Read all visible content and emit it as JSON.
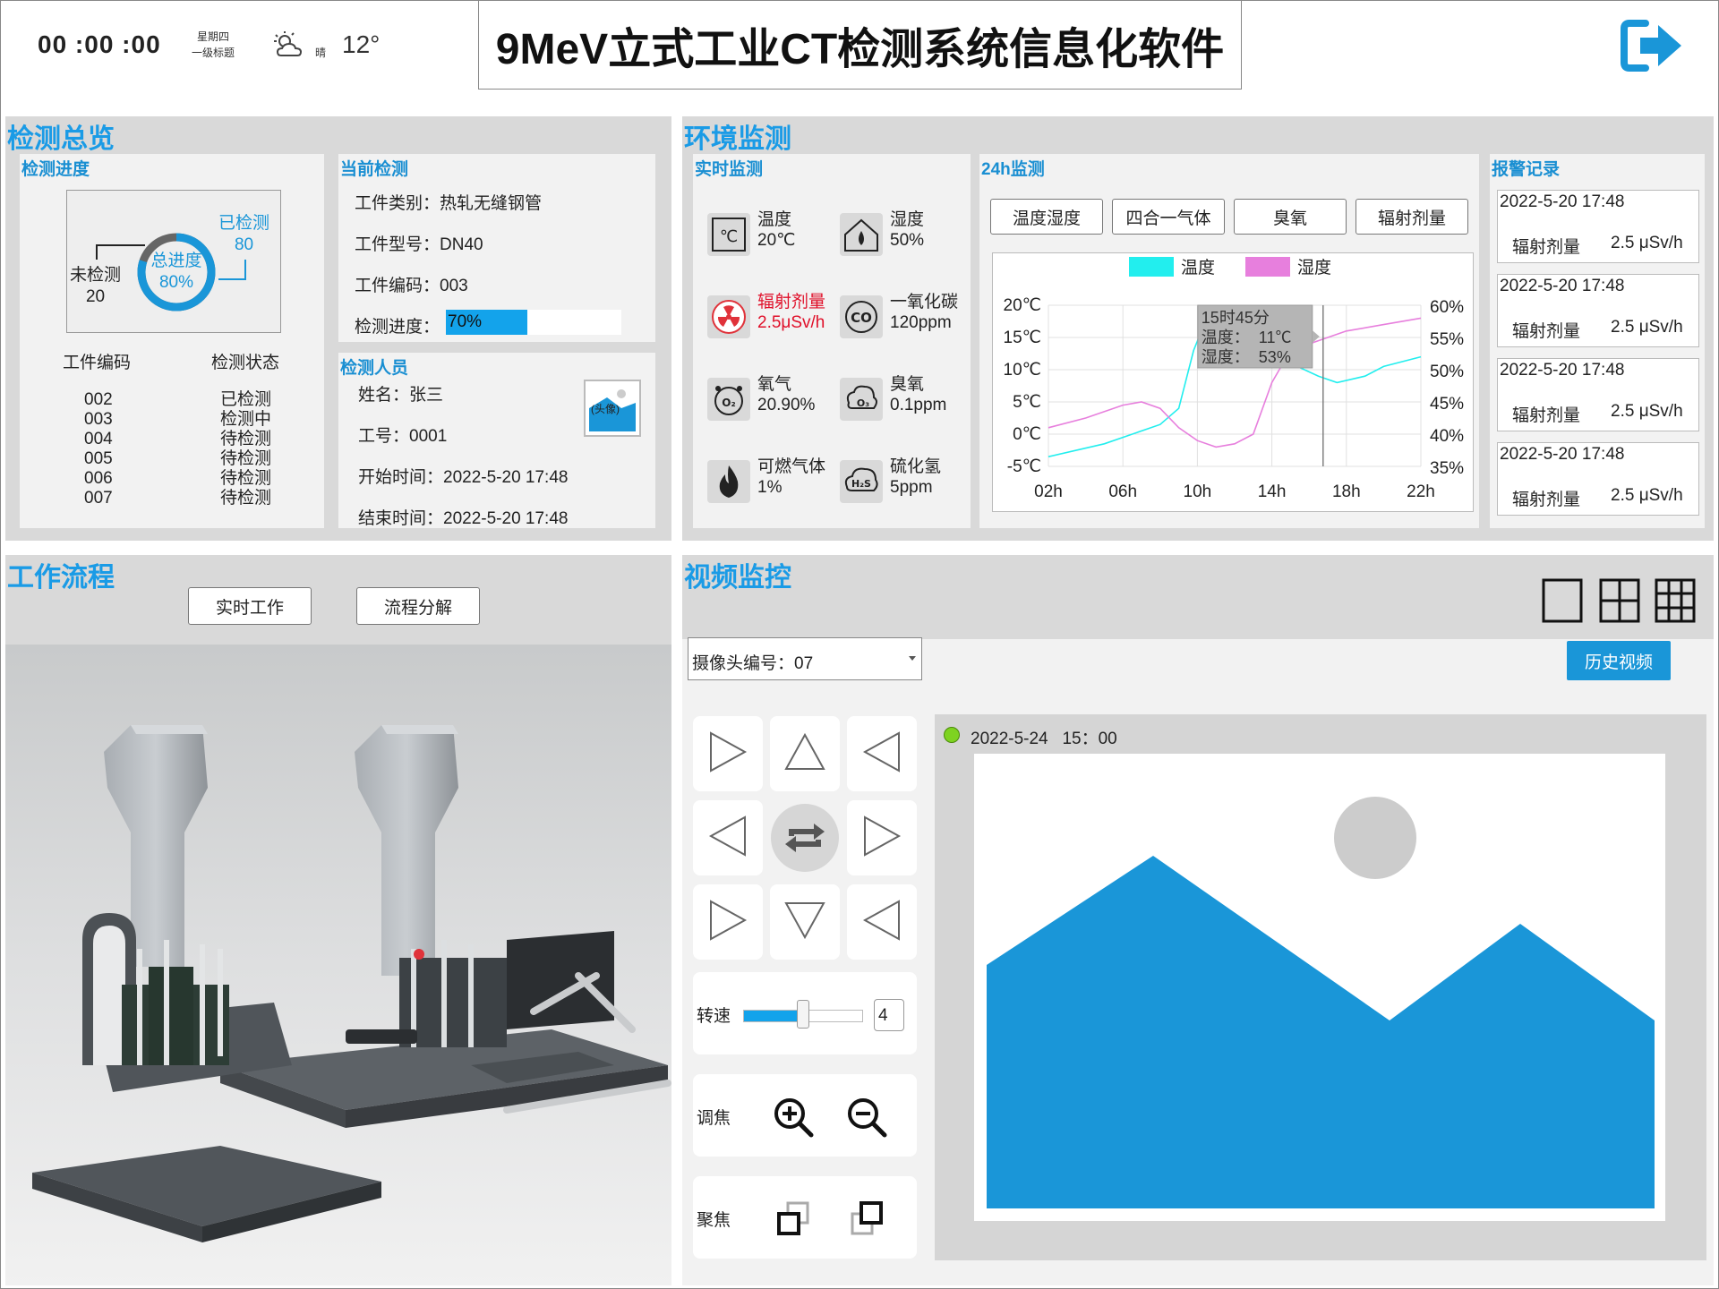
{
  "header": {
    "time": "00 :00 :00",
    "weekday": "星期四",
    "weekday_sub": "一级标题",
    "weather_text": "晴",
    "temperature": "12°",
    "title": "9MeV立式工业CT检测系统信息化软件",
    "logout_icon": "logout-icon"
  },
  "overview": {
    "section_title": "检测总览",
    "progress": {
      "title": "检测进度",
      "inspected_label": "已检测",
      "inspected_value": "80",
      "uninspected_label": "未检测",
      "uninspected_value": "20",
      "total_label": "总进度",
      "total_value": "80%",
      "total_fraction": 0.8,
      "col_code": "工件编码",
      "col_status": "检测状态",
      "rows": [
        {
          "code": "002",
          "status": "已检测"
        },
        {
          "code": "003",
          "status": "检测中"
        },
        {
          "code": "004",
          "status": "待检测"
        },
        {
          "code": "005",
          "status": "待检测"
        },
        {
          "code": "006",
          "status": "待检测"
        },
        {
          "code": "007",
          "status": "待检测"
        }
      ]
    },
    "current": {
      "title": "当前检测",
      "type_label": "工件类别：",
      "type_value": "热轧无缝钢管",
      "model_label": "工件型号：",
      "model_value": "DN40",
      "code_label": "工件编码：",
      "code_value": "003",
      "progress_label": "检测进度：",
      "progress_value": "70%",
      "progress_fraction": 0.7
    },
    "staff": {
      "title": "检测人员",
      "name_label": "姓名：",
      "name_value": "张三",
      "id_label": "工号：",
      "id_value": "0001",
      "start_label": "开始时间：",
      "start_value": "2022-5-20 17:48",
      "end_label": "结束时间：",
      "end_value": "2022-5-20 17:48",
      "avatar_text": "(头像)"
    }
  },
  "env": {
    "section_title": "环境监测",
    "realtime": {
      "title": "实时监测",
      "items": [
        {
          "name": "温度",
          "value": "20℃",
          "icon": "thermometer-icon",
          "alert": false
        },
        {
          "name": "湿度",
          "value": "50%",
          "icon": "humidity-icon",
          "alert": false
        },
        {
          "name": "辐射剂量",
          "value": "2.5μSv/h",
          "icon": "radiation-icon",
          "alert": true
        },
        {
          "name": "一氧化碳",
          "value": "120ppm",
          "icon": "co-icon",
          "alert": false
        },
        {
          "name": "氧气",
          "value": "20.90%",
          "icon": "oxygen-icon",
          "alert": false
        },
        {
          "name": "臭氧",
          "value": "0.1ppm",
          "icon": "ozone-icon",
          "alert": false
        },
        {
          "name": "可燃气体",
          "value": "1%",
          "icon": "flame-icon",
          "alert": false
        },
        {
          "name": "硫化氢",
          "value": "5ppm",
          "icon": "h2s-icon",
          "alert": false
        }
      ]
    },
    "h24": {
      "title": "24h监测",
      "tabs": [
        "温度湿度",
        "四合一气体",
        "臭氧",
        "辐射剂量"
      ]
    },
    "alarms": {
      "title": "报警记录",
      "records": [
        {
          "time": "2022-5-20 17:48",
          "type": "辐射剂量",
          "value": "2.5 μSv/h"
        },
        {
          "time": "2022-5-20 17:48",
          "type": "辐射剂量",
          "value": "2.5 μSv/h"
        },
        {
          "time": "2022-5-20 17:48",
          "type": "辐射剂量",
          "value": "2.5 μSv/h"
        },
        {
          "time": "2022-5-20 17:48",
          "type": "辐射剂量",
          "value": "2.5 μSv/h"
        }
      ]
    }
  },
  "chart_data": {
    "type": "line",
    "legend_placement": "top",
    "x_ticks": [
      "02h",
      "06h",
      "10h",
      "14h",
      "18h",
      "22h"
    ],
    "y_left_ticks": [
      "20℃",
      "15℃",
      "10℃",
      "5℃",
      "0℃",
      "-5℃"
    ],
    "y_right_ticks": [
      "60%",
      "55%",
      "50%",
      "45%",
      "40%",
      "35%"
    ],
    "y_left_range": [
      -5,
      20
    ],
    "y_right_range": [
      35,
      60
    ],
    "x_range": [
      2,
      22
    ],
    "grid": true,
    "series": [
      {
        "name": "温度",
        "color": "#22eeee",
        "axis": "left",
        "points": [
          [
            2,
            -3.5
          ],
          [
            5,
            -1.5
          ],
          [
            8,
            1.5
          ],
          [
            9,
            4
          ],
          [
            9.8,
            13
          ],
          [
            10.5,
            18
          ],
          [
            11.5,
            18
          ],
          [
            13,
            13
          ],
          [
            14,
            13
          ],
          [
            15,
            11
          ],
          [
            16.5,
            9
          ],
          [
            17.5,
            8
          ],
          [
            19,
            9
          ],
          [
            20,
            10.5
          ],
          [
            22,
            12
          ]
        ]
      },
      {
        "name": "湿度",
        "color": "#e77fdd",
        "axis": "left",
        "points": [
          [
            2,
            1
          ],
          [
            4,
            2.5
          ],
          [
            6,
            4.5
          ],
          [
            7,
            5
          ],
          [
            8,
            4
          ],
          [
            9,
            1
          ],
          [
            10,
            -1
          ],
          [
            11,
            -2
          ],
          [
            12,
            -1.5
          ],
          [
            13,
            0
          ],
          [
            14,
            8
          ],
          [
            15,
            13
          ],
          [
            16,
            14
          ],
          [
            17,
            15
          ],
          [
            18,
            16
          ],
          [
            20,
            17
          ],
          [
            22,
            18
          ]
        ]
      }
    ],
    "tooltip": {
      "line1": "15时45分",
      "line2": "温度：  11℃",
      "line3": "湿度：  53%",
      "x": 15.75
    }
  },
  "workflow": {
    "section_title": "工作流程",
    "btn_realtime": "实时工作",
    "btn_breakdown": "流程分解"
  },
  "video": {
    "section_title": "视频监控",
    "layout_icons": [
      "single-view-icon",
      "quad-view-icon",
      "nine-view-icon"
    ],
    "camera_label": "摄像头编号：",
    "camera_value": "07",
    "history_btn": "历史视频",
    "timestamp": "2022-5-24   15：00",
    "status_color": "#7ed321",
    "speed_label": "转速",
    "speed_value": "4",
    "speed_fraction": 0.5,
    "zoom_label": "调焦",
    "focus_label": "聚焦"
  }
}
